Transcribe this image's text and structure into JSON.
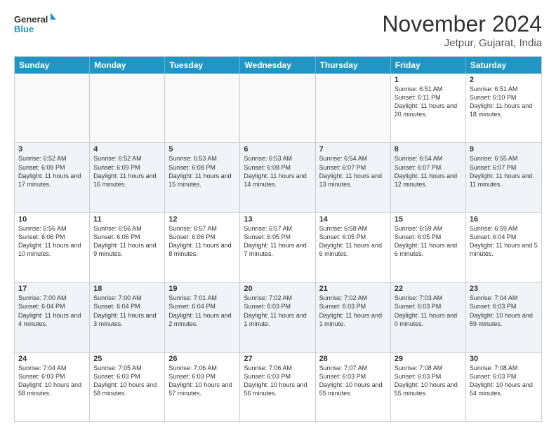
{
  "header": {
    "logo_general": "General",
    "logo_blue": "Blue",
    "month_title": "November 2024",
    "location": "Jetpur, Gujarat, India"
  },
  "calendar": {
    "days_of_week": [
      "Sunday",
      "Monday",
      "Tuesday",
      "Wednesday",
      "Thursday",
      "Friday",
      "Saturday"
    ],
    "rows": [
      [
        {
          "day": "",
          "text": ""
        },
        {
          "day": "",
          "text": ""
        },
        {
          "day": "",
          "text": ""
        },
        {
          "day": "",
          "text": ""
        },
        {
          "day": "",
          "text": ""
        },
        {
          "day": "1",
          "text": "Sunrise: 6:51 AM\nSunset: 6:11 PM\nDaylight: 11 hours and 20 minutes."
        },
        {
          "day": "2",
          "text": "Sunrise: 6:51 AM\nSunset: 6:10 PM\nDaylight: 11 hours and 18 minutes."
        }
      ],
      [
        {
          "day": "3",
          "text": "Sunrise: 6:52 AM\nSunset: 6:09 PM\nDaylight: 11 hours and 17 minutes."
        },
        {
          "day": "4",
          "text": "Sunrise: 6:52 AM\nSunset: 6:09 PM\nDaylight: 11 hours and 16 minutes."
        },
        {
          "day": "5",
          "text": "Sunrise: 6:53 AM\nSunset: 6:08 PM\nDaylight: 11 hours and 15 minutes."
        },
        {
          "day": "6",
          "text": "Sunrise: 6:53 AM\nSunset: 6:08 PM\nDaylight: 11 hours and 14 minutes."
        },
        {
          "day": "7",
          "text": "Sunrise: 6:54 AM\nSunset: 6:07 PM\nDaylight: 11 hours and 13 minutes."
        },
        {
          "day": "8",
          "text": "Sunrise: 6:54 AM\nSunset: 6:07 PM\nDaylight: 11 hours and 12 minutes."
        },
        {
          "day": "9",
          "text": "Sunrise: 6:55 AM\nSunset: 6:07 PM\nDaylight: 11 hours and 11 minutes."
        }
      ],
      [
        {
          "day": "10",
          "text": "Sunrise: 6:56 AM\nSunset: 6:06 PM\nDaylight: 11 hours and 10 minutes."
        },
        {
          "day": "11",
          "text": "Sunrise: 6:56 AM\nSunset: 6:06 PM\nDaylight: 11 hours and 9 minutes."
        },
        {
          "day": "12",
          "text": "Sunrise: 6:57 AM\nSunset: 6:06 PM\nDaylight: 11 hours and 8 minutes."
        },
        {
          "day": "13",
          "text": "Sunrise: 6:57 AM\nSunset: 6:05 PM\nDaylight: 11 hours and 7 minutes."
        },
        {
          "day": "14",
          "text": "Sunrise: 6:58 AM\nSunset: 6:05 PM\nDaylight: 11 hours and 6 minutes."
        },
        {
          "day": "15",
          "text": "Sunrise: 6:59 AM\nSunset: 6:05 PM\nDaylight: 11 hours and 6 minutes."
        },
        {
          "day": "16",
          "text": "Sunrise: 6:59 AM\nSunset: 6:04 PM\nDaylight: 11 hours and 5 minutes."
        }
      ],
      [
        {
          "day": "17",
          "text": "Sunrise: 7:00 AM\nSunset: 6:04 PM\nDaylight: 11 hours and 4 minutes."
        },
        {
          "day": "18",
          "text": "Sunrise: 7:00 AM\nSunset: 6:04 PM\nDaylight: 11 hours and 3 minutes."
        },
        {
          "day": "19",
          "text": "Sunrise: 7:01 AM\nSunset: 6:04 PM\nDaylight: 11 hours and 2 minutes."
        },
        {
          "day": "20",
          "text": "Sunrise: 7:02 AM\nSunset: 6:03 PM\nDaylight: 11 hours and 1 minute."
        },
        {
          "day": "21",
          "text": "Sunrise: 7:02 AM\nSunset: 6:03 PM\nDaylight: 11 hours and 1 minute."
        },
        {
          "day": "22",
          "text": "Sunrise: 7:03 AM\nSunset: 6:03 PM\nDaylight: 11 hours and 0 minutes."
        },
        {
          "day": "23",
          "text": "Sunrise: 7:04 AM\nSunset: 6:03 PM\nDaylight: 10 hours and 59 minutes."
        }
      ],
      [
        {
          "day": "24",
          "text": "Sunrise: 7:04 AM\nSunset: 6:03 PM\nDaylight: 10 hours and 58 minutes."
        },
        {
          "day": "25",
          "text": "Sunrise: 7:05 AM\nSunset: 6:03 PM\nDaylight: 10 hours and 58 minutes."
        },
        {
          "day": "26",
          "text": "Sunrise: 7:06 AM\nSunset: 6:03 PM\nDaylight: 10 hours and 57 minutes."
        },
        {
          "day": "27",
          "text": "Sunrise: 7:06 AM\nSunset: 6:03 PM\nDaylight: 10 hours and 56 minutes."
        },
        {
          "day": "28",
          "text": "Sunrise: 7:07 AM\nSunset: 6:03 PM\nDaylight: 10 hours and 55 minutes."
        },
        {
          "day": "29",
          "text": "Sunrise: 7:08 AM\nSunset: 6:03 PM\nDaylight: 10 hours and 55 minutes."
        },
        {
          "day": "30",
          "text": "Sunrise: 7:08 AM\nSunset: 6:03 PM\nDaylight: 10 hours and 54 minutes."
        }
      ]
    ]
  }
}
